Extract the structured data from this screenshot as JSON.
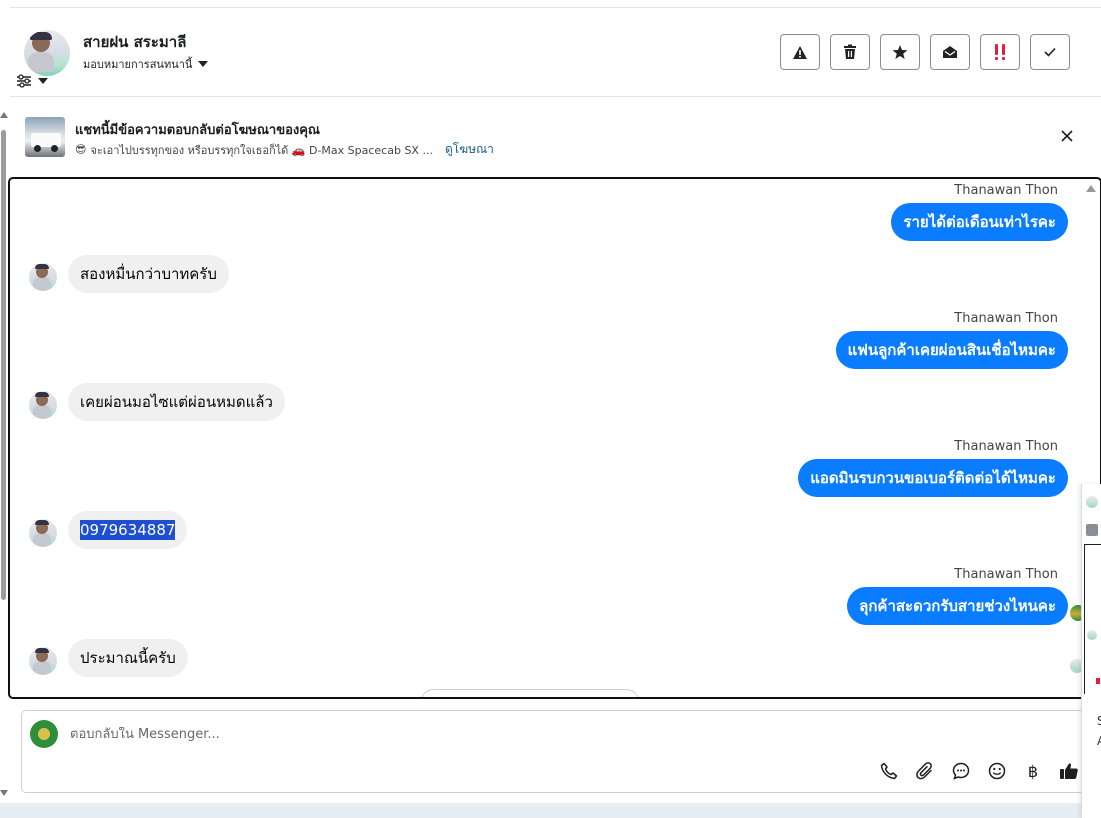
{
  "header": {
    "contact_name": "สายฝน สระมาลี",
    "assign_label": "มอบหมายการสนทนานี้",
    "actions": [
      {
        "name": "report-button",
        "icon": "warning-icon"
      },
      {
        "name": "delete-button",
        "icon": "trash-icon"
      },
      {
        "name": "star-button",
        "icon": "star-icon"
      },
      {
        "name": "mark-unread-button",
        "icon": "envelope-open-icon"
      },
      {
        "name": "follow-up-button",
        "icon": "exclamation-icon"
      },
      {
        "name": "mark-done-button",
        "icon": "check-icon"
      }
    ]
  },
  "ad_banner": {
    "title": "แชทนี้มีข้อความตอบกลับต่อโฆษณาของคุณ",
    "subtitle_emoji": "😎",
    "subtitle_text": "จะเอาไปบรรทุกของ หรือบรรทุกใจเธอก็ได้ 🚗 D-Max Spacecab SX ...",
    "link_label": "ดูโฆษณา"
  },
  "messages": [
    {
      "direction": "out",
      "sender": "Thanawan Thon",
      "text": "รายได้ต่อเดือนเท่าไรคะ"
    },
    {
      "direction": "in",
      "text": "สองหมื่นกว่าบาทครับ"
    },
    {
      "direction": "out",
      "sender": "Thanawan Thon",
      "text": "แฟนลูกค้าเคยผ่อนสินเชื่อไหมคะ"
    },
    {
      "direction": "in",
      "text": "เคยผ่อนมอไซแต่ผ่อนหมดแล้ว"
    },
    {
      "direction": "out",
      "sender": "Thanawan Thon",
      "text": "แอดมินรบกวนขอเบอร์ติดต่อได้ไหมคะ"
    },
    {
      "direction": "in",
      "text": "0979634887",
      "selected": true
    },
    {
      "direction": "out",
      "sender": "Thanawan Thon",
      "text": "ลุกค้าสะดวกรับสายช่วงไหนคะ"
    },
    {
      "direction": "in",
      "text": "ประมาณนี้ครับ"
    }
  ],
  "composer": {
    "placeholder": "ตอบกลับใน Messenger...",
    "tools": [
      "phone-icon",
      "paperclip-icon",
      "saved-reply-icon",
      "emoji-icon",
      "baht-icon",
      "thumbs-up-icon"
    ],
    "baht_symbol": "฿"
  },
  "colors": {
    "outgoing_bubble": "#0a7cff",
    "incoming_bubble": "#f0f0f0",
    "selection": "#1f4fd1",
    "follow_up_red": "#e41e3f"
  },
  "side_panel": {
    "text_1": "S",
    "text_2": "A"
  }
}
